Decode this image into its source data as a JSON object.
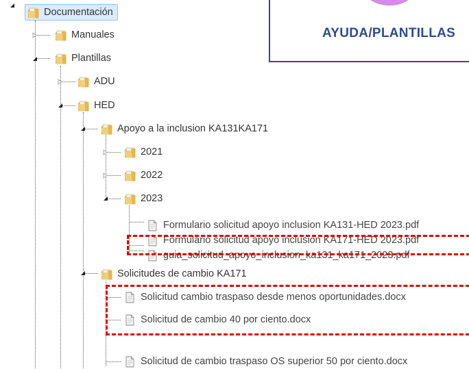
{
  "tree": {
    "root": {
      "label": "Documentación",
      "icon": "folder-icon"
    },
    "manuales": {
      "label": "Manuales",
      "icon": "folder-icon"
    },
    "plantillas": {
      "label": "Plantillas",
      "icon": "folder-icon"
    },
    "adu": {
      "label": "ADU",
      "icon": "folder-icon"
    },
    "hed": {
      "label": "HED",
      "icon": "folder-icon"
    },
    "apoyo": {
      "label": "Apoyo a la inclusion KA131KA171",
      "icon": "folder-icon"
    },
    "y2021": {
      "label": "2021",
      "icon": "folder-icon"
    },
    "y2022": {
      "label": "2022",
      "icon": "folder-icon"
    },
    "y2023": {
      "label": "2023",
      "icon": "folder-icon"
    },
    "files2023": [
      {
        "label": "Formulario solicitud apoyo inclusion KA131-HED 2023.pdf",
        "icon": "pdf-file-icon"
      },
      {
        "label": "Formulario solicitud apoyo inclusion KA171-HED 2023.pdf",
        "icon": "pdf-file-icon"
      },
      {
        "label": "guia_solicitud_apoyo_inclusion_ka131_ka171_2023.pdf",
        "icon": "pdf-file-icon"
      }
    ],
    "solicitudes": {
      "label": "Solicitudes de cambio KA171",
      "icon": "folder-icon"
    },
    "solicitudes_files": [
      {
        "label": "Solicitud cambio traspaso desde menos oportunidades.docx",
        "icon": "docx-file-icon"
      },
      {
        "label": "Solicitud de cambio 40 por ciento.docx",
        "icon": "docx-file-icon"
      },
      {
        "label": "Solicitud de cambio traspaso OS superior 50 por ciento.docx",
        "icon": "docx-file-icon"
      }
    ]
  },
  "banner": {
    "title": "AYUDA/PLANTILLAS"
  },
  "colors": {
    "selection_bg": "#dcebfc",
    "selection_border": "#8ec3f5",
    "highlight_dash": "#e00000",
    "banner_border": "#2e4b8f",
    "banner_text": "#2d4b8e",
    "banner_circle": "#d58be8"
  }
}
